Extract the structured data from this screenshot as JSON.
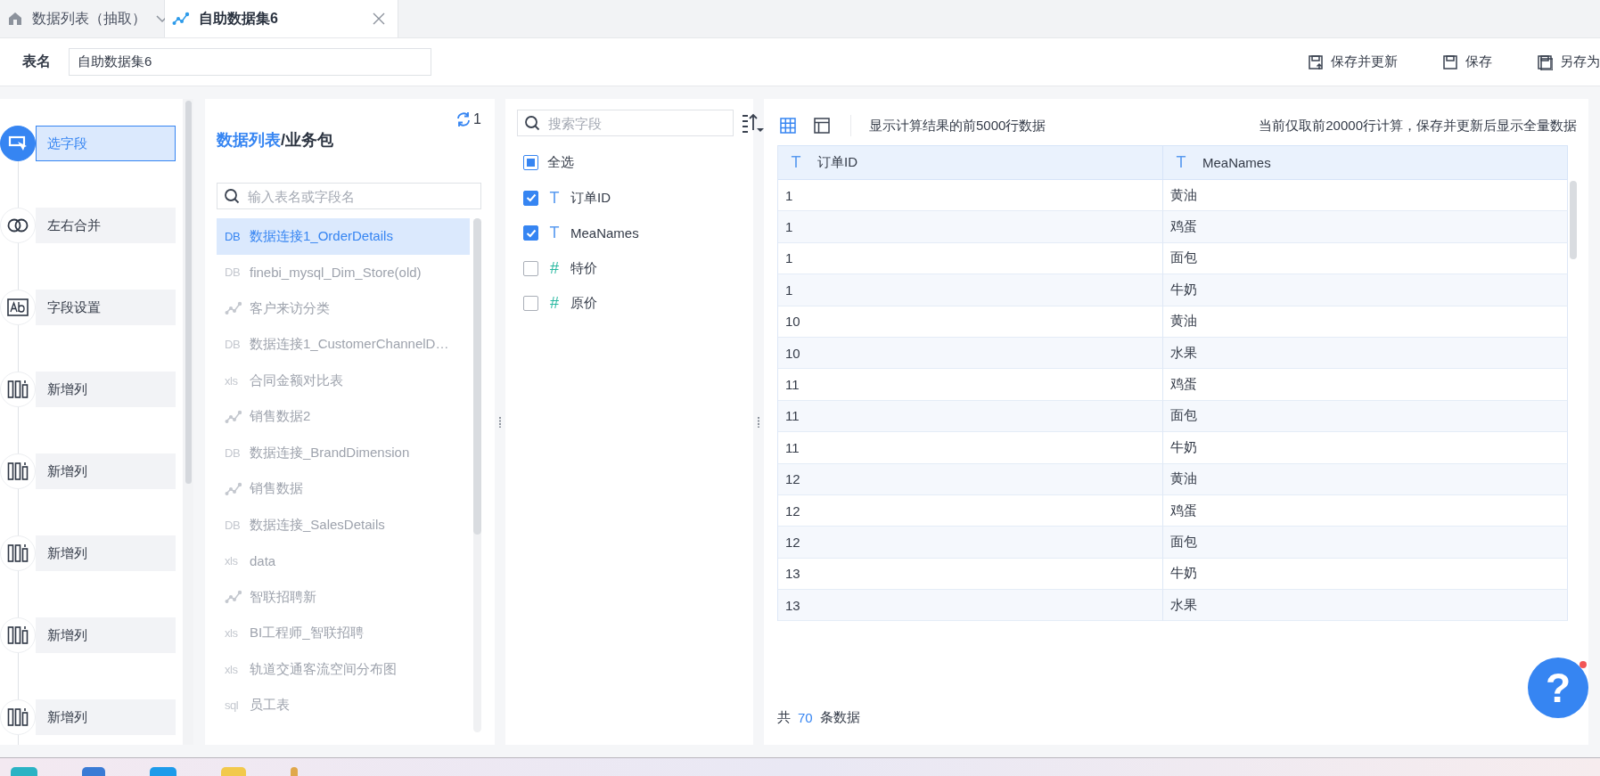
{
  "tabs": [
    {
      "kind": "home",
      "label": "数据列表（抽取）",
      "selected": false
    },
    {
      "kind": "dataset",
      "label": "自助数据集6",
      "selected": true
    }
  ],
  "header": {
    "label": "表名",
    "value": "自助数据集6",
    "actions": [
      {
        "kind": "update",
        "label": "保存并更新"
      },
      {
        "kind": "save",
        "label": "保存"
      },
      {
        "kind": "save-as",
        "label": "另存为"
      }
    ]
  },
  "steps": [
    {
      "kind": "select",
      "label": "选字段",
      "selected": true
    },
    {
      "kind": "merge",
      "label": "左右合并",
      "selected": false
    },
    {
      "kind": "field",
      "label": "字段设置",
      "selected": false
    },
    {
      "kind": "column",
      "label": "新增列",
      "selected": false
    },
    {
      "kind": "column",
      "label": "新增列",
      "selected": false
    },
    {
      "kind": "column",
      "label": "新增列",
      "selected": false
    },
    {
      "kind": "column",
      "label": "新增列",
      "selected": false
    },
    {
      "kind": "column",
      "label": "新增列",
      "selected": false
    }
  ],
  "tables_panel": {
    "title_highlight": "数据列表",
    "title_rest": "/业务包",
    "refresh_count": "1",
    "search_placeholder": "输入表名或字段名",
    "items": [
      {
        "kind": "source",
        "badge": "DB",
        "label": "数据连接1_OrderDetails",
        "selected": true
      },
      {
        "kind": "source",
        "badge": "DB",
        "label": "finebi_mysql_Dim_Store(old)",
        "selected": false
      },
      {
        "kind": "dataset",
        "label": "客户来访分类",
        "selected": false
      },
      {
        "kind": "source",
        "badge": "DB",
        "label": "数据连接1_CustomerChannelD…",
        "selected": false
      },
      {
        "kind": "source",
        "badge": "xls",
        "label": "合同金额对比表",
        "selected": false
      },
      {
        "kind": "dataset",
        "label": "销售数据2",
        "selected": false
      },
      {
        "kind": "source",
        "badge": "DB",
        "label": "数据连接_BrandDimension",
        "selected": false
      },
      {
        "kind": "dataset",
        "label": "销售数据",
        "selected": false
      },
      {
        "kind": "source",
        "badge": "DB",
        "label": "数据连接_SalesDetails",
        "selected": false
      },
      {
        "kind": "source",
        "badge": "xls",
        "label": "data",
        "selected": false
      },
      {
        "kind": "dataset",
        "label": "智联招聘新",
        "selected": false
      },
      {
        "kind": "source",
        "badge": "xls",
        "label": "BI工程师_智联招聘",
        "selected": false
      },
      {
        "kind": "source",
        "badge": "xls",
        "label": "轨道交通客流空间分布图",
        "selected": false
      },
      {
        "kind": "source",
        "badge": "sql",
        "label": "员工表",
        "selected": false
      }
    ]
  },
  "fields_panel": {
    "search_placeholder": "搜索字段",
    "select_all": {
      "label": "全选",
      "checked": false,
      "indeterminate": true
    },
    "fields": [
      {
        "kind": "text",
        "mark": "T",
        "label": "订单ID",
        "checked": true
      },
      {
        "kind": "text",
        "mark": "T",
        "label": "MeaNames",
        "checked": true
      },
      {
        "kind": "number",
        "mark": "#",
        "label": "特价",
        "checked": false
      },
      {
        "kind": "number",
        "mark": "#",
        "label": "原价",
        "checked": false
      }
    ]
  },
  "preview": {
    "view_modes": [
      {
        "kind": "grid",
        "selected": true
      },
      {
        "kind": "layout",
        "selected": false
      }
    ],
    "info_left": "显示计算结果的前5000行数据",
    "info_right": "当前仅取前20000行计算，保存并更新后显示全量数据",
    "columns": [
      {
        "mark": "T",
        "label": "订单ID"
      },
      {
        "mark": "T",
        "label": "MeaNames"
      }
    ],
    "rows": [
      [
        "1",
        "黄油"
      ],
      [
        "1",
        "鸡蛋"
      ],
      [
        "1",
        "面包"
      ],
      [
        "1",
        "牛奶"
      ],
      [
        "10",
        "黄油"
      ],
      [
        "10",
        "水果"
      ],
      [
        "11",
        "鸡蛋"
      ],
      [
        "11",
        "面包"
      ],
      [
        "11",
        "牛奶"
      ],
      [
        "12",
        "黄油"
      ],
      [
        "12",
        "鸡蛋"
      ],
      [
        "12",
        "面包"
      ],
      [
        "13",
        "牛奶"
      ],
      [
        "13",
        "水果"
      ]
    ],
    "total_prefix": "共",
    "total": "70",
    "total_suffix": "条数据"
  },
  "help": {
    "mark": "?",
    "notification": true
  }
}
